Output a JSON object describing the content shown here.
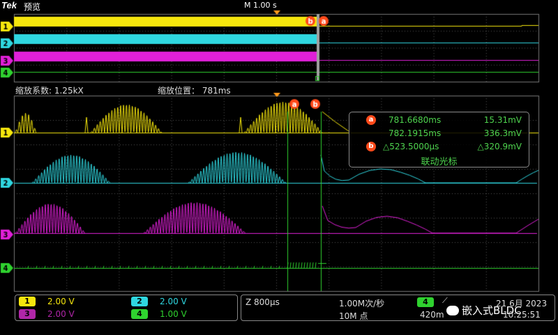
{
  "header": {
    "brand": "Tek",
    "mode": "预览",
    "timebase": "M 1.00 s"
  },
  "zoom": {
    "factor": "缩放系数: 1.25kX",
    "position": "缩放位置： 781ms"
  },
  "markers": {
    "a": "a",
    "b": "b"
  },
  "channels": [
    {
      "id": "1",
      "color": "#f5e60d",
      "scale": "2.00 V"
    },
    {
      "id": "2",
      "color": "#2fd7e0",
      "scale": "2.00 V"
    },
    {
      "id": "3",
      "color": "#e020d8",
      "scale": "2.00 V"
    },
    {
      "id": "4",
      "color": "#2fd22f",
      "scale": "1.00 V"
    }
  ],
  "cursor_readout": {
    "a_time": "781.6680ms",
    "a_volt": "15.31mV",
    "b_time": "782.1915ms",
    "b_volt": "336.3mV",
    "delta_time": "△523.5000μs",
    "delta_volt": "△320.9mV",
    "link_label": "联动光标"
  },
  "acquisition": {
    "zoom_scale": "Z 800μs",
    "sample_rate": "1.00M次/秒",
    "record_length": "10M 点",
    "trigger_channel": "4",
    "trigger_level": "420m",
    "date": "21 6月 2023",
    "time": "10:25:51"
  },
  "watermark": "嵌入式BLDC"
}
